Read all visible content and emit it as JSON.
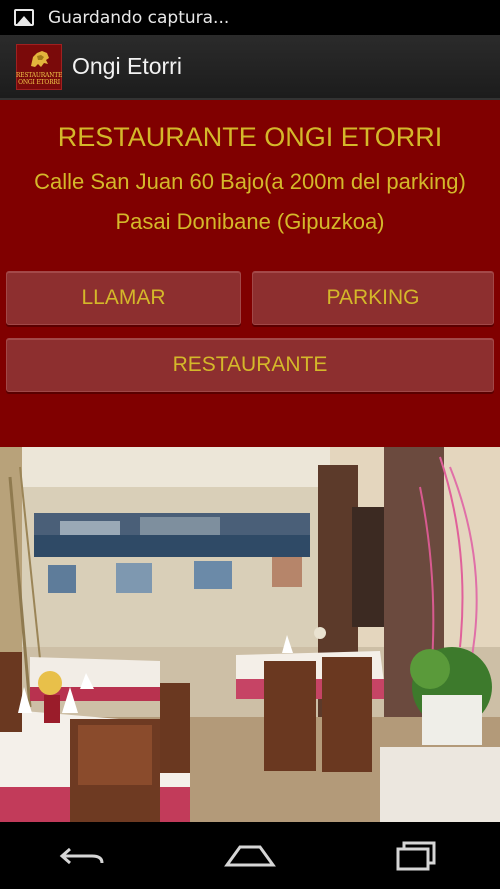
{
  "status_bar": {
    "notification_text": "Guardando captura...",
    "icon": "image-icon"
  },
  "action_bar": {
    "logo_line1": "RESTAURANTE",
    "logo_line2": "ONGI ETORRI",
    "title": "Ongi Etorri"
  },
  "header": {
    "title": "RESTAURANTE ONGI ETORRI",
    "address_line1": "Calle San Juan 60 Bajo(a 200m del parking)",
    "address_line2": "Pasai Donibane (Gipuzkoa)"
  },
  "buttons": {
    "call": "LLAMAR",
    "parking": "PARKING",
    "restaurant": "RESTAURANTE"
  },
  "nav_bar": {
    "icons": [
      "back-icon",
      "home-icon",
      "recent-apps-icon"
    ]
  },
  "colors": {
    "background": "#800000",
    "button": "#8d2f2f",
    "text_gold": "#d4b82a"
  }
}
